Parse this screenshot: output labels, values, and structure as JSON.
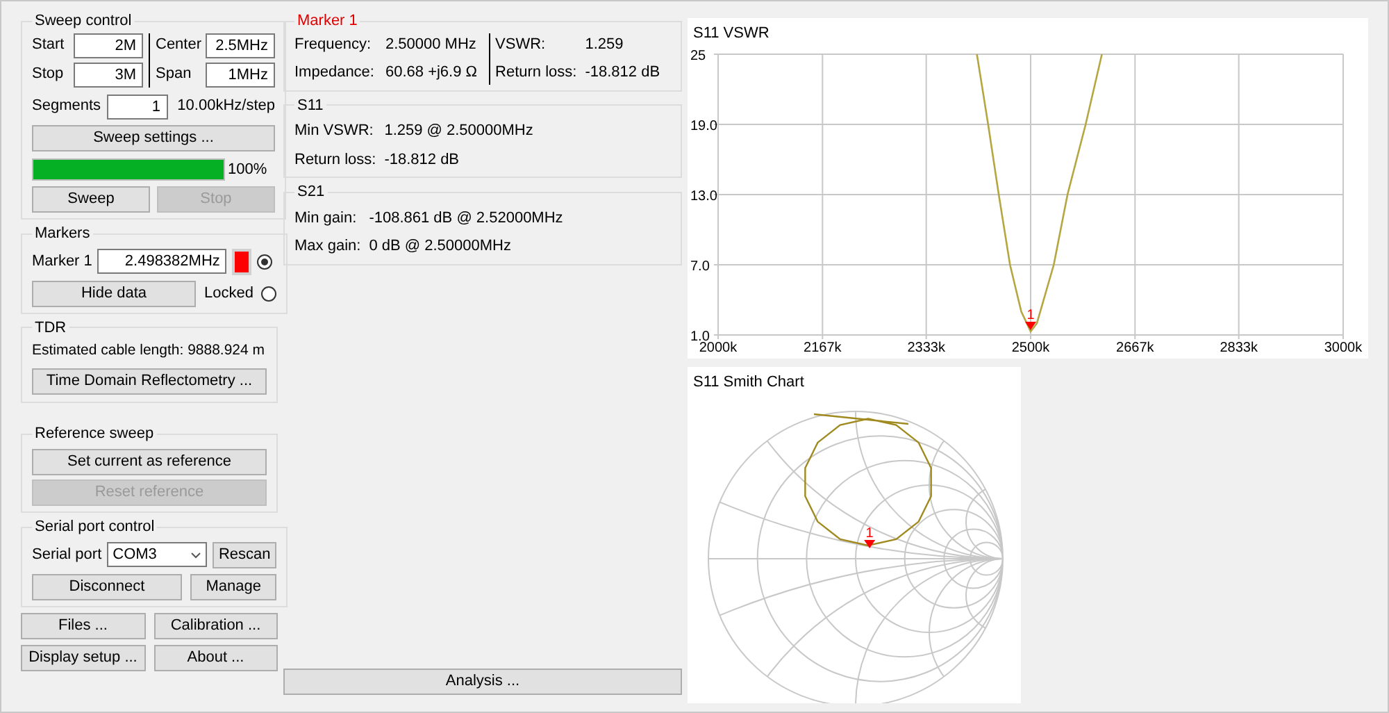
{
  "sweep_control": {
    "title": "Sweep control",
    "fields": [
      {
        "label": "Start",
        "value": "2M"
      },
      {
        "label": "Center",
        "value": "2.5MHz"
      },
      {
        "label": "Stop",
        "value": "3M"
      },
      {
        "label": "Span",
        "value": "1MHz"
      }
    ],
    "segments": {
      "label": "Segments",
      "value": "1"
    },
    "step": "10.00kHz/step",
    "settings_button": "Sweep settings ...",
    "progress": {
      "level": 1.0,
      "reading": "100%"
    },
    "buttons": [
      {
        "label": "Sweep",
        "disabled": false
      },
      {
        "label": "Stop",
        "disabled": true
      }
    ]
  },
  "markers": {
    "title": "Markers",
    "items": [
      {
        "label": "Marker 1",
        "value": "2.498382MHz",
        "color": "#ff0000",
        "selected": true
      }
    ],
    "hide_button": "Hide data",
    "locked": {
      "label": "Locked",
      "checked": false
    }
  },
  "tdr": {
    "title": "TDR",
    "estimate": "Estimated cable length: 9888.924 m",
    "button": "Time Domain Reflectometry ..."
  },
  "reference_sweep": {
    "title": "Reference sweep",
    "buttons": [
      {
        "label": "Set current as reference",
        "disabled": false
      },
      {
        "label": "Reset reference",
        "disabled": true
      }
    ]
  },
  "serial_port": {
    "title": "Serial port control",
    "label": "Serial port",
    "port": "COM3",
    "rescan_button": "Rescan",
    "disconnect_button": "Disconnect",
    "manage_button": "Manage"
  },
  "bottom_buttons": [
    "Files ...",
    "Calibration ...",
    "Display setup ...",
    "About ..."
  ],
  "marker_info": {
    "title": "Marker 1",
    "rows_left": [
      {
        "label": "Frequency:",
        "value": "2.50000 MHz"
      },
      {
        "label": "Impedance:",
        "value": "60.68 +j6.9 Ω"
      }
    ],
    "rows_right": [
      {
        "label": "VSWR:",
        "value": "1.259"
      },
      {
        "label": "Return loss:",
        "value": "-18.812 dB"
      }
    ]
  },
  "s11": {
    "title": "S11",
    "rows": [
      {
        "label": "Min VSWR:",
        "value": "1.259 @ 2.50000MHz"
      },
      {
        "label": "Return loss:",
        "value": "-18.812 dB"
      }
    ]
  },
  "s21": {
    "title": "S21",
    "rows": [
      {
        "label": "Min gain:",
        "value": "-108.861 dB @ 2.52000MHz"
      },
      {
        "label": "Max gain:",
        "value": "0 dB @ 2.50000MHz"
      }
    ]
  },
  "analysis_button": "Analysis ...",
  "vswr_chart": {
    "marker": "1",
    "chart_data": {
      "type": "line",
      "title": "S11 VSWR",
      "grid": true,
      "xlim": [
        2000,
        3000
      ],
      "ylim": [
        1,
        25
      ],
      "xticks": [
        {
          "value": 2000,
          "label": "2000k"
        },
        {
          "value": 2167,
          "label": "2167k"
        },
        {
          "value": 2333,
          "label": "2333k"
        },
        {
          "value": 2500,
          "label": "2500k"
        },
        {
          "value": 2667,
          "label": "2667k"
        },
        {
          "value": 2833,
          "label": "2833k"
        },
        {
          "value": 3000,
          "label": "3000k"
        }
      ],
      "yticks": [
        {
          "value": 1,
          "label": "1.0"
        },
        {
          "value": 7,
          "label": "7.0"
        },
        {
          "value": 13,
          "label": "13.0"
        },
        {
          "value": 19,
          "label": "19.0"
        },
        {
          "value": 25,
          "label": "25"
        }
      ],
      "x": [
        2414,
        2432,
        2449,
        2467,
        2485,
        2500,
        2510,
        2537,
        2559,
        2588,
        2614
      ],
      "series": [
        {
          "color": "#b5a642",
          "values": [
            25,
            19,
            13,
            7,
            3,
            1.3,
            2,
            7,
            13,
            19,
            25
          ]
        }
      ]
    }
  },
  "smith_chart": {
    "title": "S11 Smith Chart",
    "marker": "1"
  }
}
